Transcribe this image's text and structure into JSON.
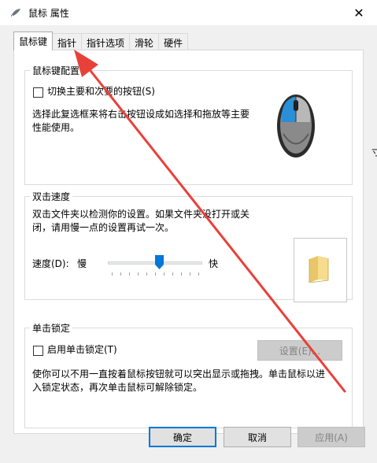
{
  "window": {
    "title": "鼠标 属性",
    "close_glyph": "✕"
  },
  "background": {
    "partial_char": "寸"
  },
  "tabs": [
    {
      "label": "鼠标键",
      "active": true
    },
    {
      "label": "指针",
      "active": false
    },
    {
      "label": "指针选项",
      "active": false
    },
    {
      "label": "滑轮",
      "active": false
    },
    {
      "label": "硬件",
      "active": false
    }
  ],
  "button_config": {
    "group_title": "鼠标键配置",
    "switch_label": "切换主要和次要的按钮(S)",
    "switch_checked": false,
    "description_line1": "选择此复选框来将右击按钮设成如选择和拖放等主要",
    "description_line2": "性能使用。"
  },
  "double_click": {
    "group_title": "双击速度",
    "description_line1": "双击文件夹以检测你的设置。如果文件夹没打开或关",
    "description_line2": "闭，请用慢一点的设置再试一次。",
    "speed_label": "速度(D):",
    "slow_label": "慢",
    "fast_label": "快",
    "speed_value_fraction": 0.55
  },
  "click_lock": {
    "group_title": "单击锁定",
    "enable_label": "启用单击锁定(T)",
    "enable_checked": false,
    "settings_label": "设置(E)...",
    "description_line1": "使你可以不用一直按着鼠标按钮就可以突出显示或拖拽。单击鼠标以进",
    "description_line2": "入锁定状态，再次单击鼠标可解除锁定。"
  },
  "footer": {
    "ok_label": "确定",
    "cancel_label": "取消",
    "apply_label": "应用(A)"
  },
  "colors": {
    "accent": "#0078d7",
    "annotation_arrow": "#e8413a",
    "mouse_blue": "#2a8fd6"
  }
}
